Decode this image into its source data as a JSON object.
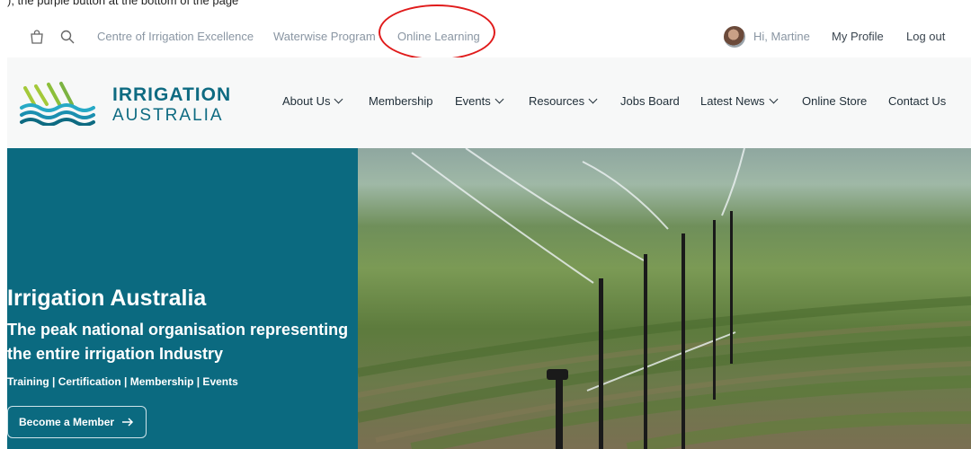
{
  "caption": "); the purple button at the bottom of the page",
  "topbar": {
    "links": [
      "Centre of Irrigation Excellence",
      "Waterwise Program",
      "Online Learning"
    ],
    "greeting": "Hi, Martine",
    "profile": "My Profile",
    "logout": "Log out",
    "highlight_color": "#e01b1b"
  },
  "brand": {
    "line1": "IRRIGATION",
    "line2": "AUSTRALIA",
    "color": "#0e6b82"
  },
  "nav": {
    "about": "About Us",
    "membership": "Membership",
    "events": "Events",
    "resources": "Resources",
    "jobs": "Jobs Board",
    "news": "Latest News",
    "store": "Online Store",
    "contact": "Contact Us"
  },
  "hero": {
    "title": "Irrigation Australia",
    "subtitle": "The peak national organisation representing the entire irrigation Industry",
    "tags": "Training | Certification | Membership | Events",
    "cta": "Become a Member",
    "panel_color": "#0b6a80"
  }
}
